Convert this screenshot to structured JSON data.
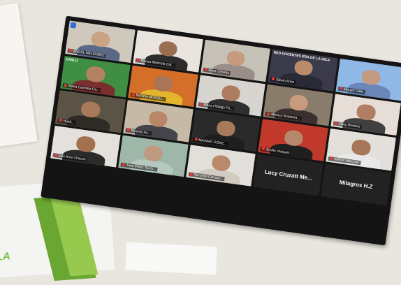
{
  "app_icon": "shield-icon",
  "participants": [
    {
      "name": "ANGEL MELENDEZ",
      "bg": "#cfc8bd",
      "skin": "#c9a384",
      "shirt": "#5a6a86"
    },
    {
      "name": "Marisa Maricela Cal...",
      "bg": "#e9e4dd",
      "skin": "#9b6e52",
      "shirt": "#2c2c2c"
    },
    {
      "name": "Nora Cepeda",
      "bg": "#c7c2b8",
      "skin": "#c69a7c",
      "shirt": "#9a8f88"
    },
    {
      "name": "Edwin Arias",
      "bg": "#3b3a4a",
      "skin": "#b98b6a",
      "shirt": "#2a2a36",
      "overlay": "RED DOCENTES ERA DE LA INCA"
    },
    {
      "name": "Margot Calle",
      "bg": "#8fb8e6",
      "skin": "#c29a80",
      "shirt": "#6a86b8"
    },
    {
      "name": "Maria Carmela Ca...",
      "bg": "#3f8e44",
      "skin": "#b38363",
      "shirt": "#7a2e2e",
      "overlay": "CARLO"
    },
    {
      "name": "MAYRA MOSQU...",
      "bg": "#d46f2a",
      "skin": "#a87558",
      "shirt": "#e3b52c"
    },
    {
      "name": "Maria Hidalgo Pa...",
      "bg": "#d8d4cf",
      "skin": "#ad7c60",
      "shirt": "#2e2e2e"
    },
    {
      "name": "Monica Bustama...",
      "bg": "#8a7c6a",
      "skin": "#c79b7d",
      "shirt": "#3b3030"
    },
    {
      "name": "Giley Romero",
      "bg": "#e6ded6",
      "skin": "#b07e62",
      "shirt": "#404040"
    },
    {
      "name": "Huldi...",
      "bg": "#5b5446",
      "skin": "#a97a5a",
      "shirt": "#2e2a24",
      "active": true
    },
    {
      "name": "Ricardo Ac...",
      "bg": "#c6b9a6",
      "skin": "#b98765",
      "shirt": "#44444a"
    },
    {
      "name": "MAXIMO GONZ...",
      "bg": "#2a2a2a",
      "skin": "#a87a5c",
      "shirt": "#1e1e1e"
    },
    {
      "name": "Emilia Vasquez",
      "bg": "#c0392b",
      "skin": "#b6886b",
      "shirt": "#1f1f1f"
    },
    {
      "name": "Wilmer Marchan",
      "bg": "#e3e0dc",
      "skin": "#a87658",
      "shirt": "#e8e8e8"
    },
    {
      "name": "Luis Arce Chacon",
      "bg": "#e4e1dd",
      "skin": "#a47150",
      "shirt": "#2b2b2b"
    },
    {
      "name": "Jane Perez Torch...",
      "bg": "#9fb7a8",
      "skin": "#c09a80",
      "shirt": "#b6c9c0"
    },
    {
      "name": "Terrones Carrasc...",
      "bg": "#e2dfda",
      "skin": "#b98a6a",
      "shirt": "#d2cbc2"
    },
    {
      "name_only": true,
      "name": "Lucy Cruzatt Me..."
    },
    {
      "name_only": true,
      "name": "Milagros H.Z"
    }
  ],
  "slide_fragment": {
    "label": "LA"
  }
}
